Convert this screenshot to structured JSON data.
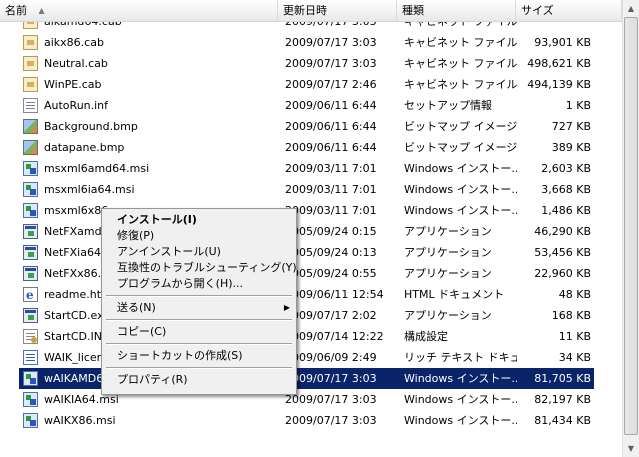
{
  "header": {
    "columns": [
      "名前",
      "更新日時",
      "種類",
      "サイズ"
    ],
    "sort_indicator": "▲"
  },
  "files": [
    {
      "name": "aikamd64.cab",
      "date": "2009/07/17 3:03",
      "type": "キャビネット ファイル",
      "size": "",
      "icon": "cabinet-file-icon"
    },
    {
      "name": "aikx86.cab",
      "date": "2009/07/17 3:03",
      "type": "キャビネット ファイル",
      "size": "93,901 KB",
      "icon": "cabinet-file-icon"
    },
    {
      "name": "Neutral.cab",
      "date": "2009/07/17 3:03",
      "type": "キャビネット ファイル",
      "size": "498,621 KB",
      "icon": "cabinet-file-icon"
    },
    {
      "name": "WinPE.cab",
      "date": "2009/07/17 2:46",
      "type": "キャビネット ファイル",
      "size": "494,139 KB",
      "icon": "cabinet-file-icon"
    },
    {
      "name": "AutoRun.inf",
      "date": "2009/06/11 6:44",
      "type": "セットアップ情報",
      "size": "1 KB",
      "icon": "setup-info-icon"
    },
    {
      "name": "Background.bmp",
      "date": "2009/06/11 6:44",
      "type": "ビットマップ イメージ",
      "size": "727 KB",
      "icon": "bitmap-image-icon"
    },
    {
      "name": "datapane.bmp",
      "date": "2009/06/11 6:44",
      "type": "ビットマップ イメージ",
      "size": "389 KB",
      "icon": "bitmap-image-icon"
    },
    {
      "name": "msxml6amd64.msi",
      "date": "2009/03/11 7:01",
      "type": "Windows インストー...",
      "size": "2,603 KB",
      "icon": "windows-installer-icon"
    },
    {
      "name": "msxml6ia64.msi",
      "date": "2009/03/11 7:01",
      "type": "Windows インストー...",
      "size": "3,668 KB",
      "icon": "windows-installer-icon"
    },
    {
      "name": "msxml6x86",
      "date": "2009/03/11 7:01",
      "type": "Windows インストー...",
      "size": "1,486 KB",
      "icon": "windows-installer-icon"
    },
    {
      "name": "NetFXamd",
      "date": "2005/09/24 0:15",
      "type": "アプリケーション",
      "size": "46,290 KB",
      "icon": "application-icon"
    },
    {
      "name": "NetFXia64.",
      "date": "2005/09/24 0:13",
      "type": "アプリケーション",
      "size": "53,456 KB",
      "icon": "application-icon"
    },
    {
      "name": "NetFXx86.e",
      "date": "2005/09/24 0:55",
      "type": "アプリケーション",
      "size": "22,960 KB",
      "icon": "application-icon"
    },
    {
      "name": "readme.htm",
      "date": "2009/06/11 12:54",
      "type": "HTML ドキュメント",
      "size": "48 KB",
      "icon": "html-document-icon"
    },
    {
      "name": "StartCD.ex",
      "date": "2009/07/17 2:02",
      "type": "アプリケーション",
      "size": "168 KB",
      "icon": "application-icon"
    },
    {
      "name": "StartCD.IN",
      "date": "2009/07/14 12:22",
      "type": "構成設定",
      "size": "11 KB",
      "icon": "config-settings-icon"
    },
    {
      "name": "WAIK_licen",
      "date": "2009/06/09 2:49",
      "type": "リッチ テキスト ドキュ...",
      "size": "34 KB",
      "icon": "rich-text-icon"
    },
    {
      "name": "wAIKAMD64.msi",
      "date": "2009/07/17 3:03",
      "type": "Windows インストー...",
      "size": "81,705 KB",
      "icon": "windows-installer-icon",
      "selected": true
    },
    {
      "name": "wAIKIA64.msi",
      "date": "2009/07/17 3:03",
      "type": "Windows インストー...",
      "size": "82,197 KB",
      "icon": "windows-installer-icon"
    },
    {
      "name": "wAIKX86.msi",
      "date": "2009/07/17 3:03",
      "type": "Windows インストー...",
      "size": "81,434 KB",
      "icon": "windows-installer-icon"
    }
  ],
  "context_menu": [
    {
      "label": "インストール(I)",
      "bold": true,
      "name": "install"
    },
    {
      "label": "修復(P)",
      "name": "repair"
    },
    {
      "label": "アンインストール(U)",
      "name": "uninstall"
    },
    {
      "label": "互換性のトラブルシューティング(Y)",
      "name": "troubleshoot-compatibility"
    },
    {
      "label": "プログラムから開く(H)...",
      "name": "open-with"
    },
    {
      "separator": true
    },
    {
      "label": "送る(N)",
      "submenu": true,
      "name": "send-to"
    },
    {
      "separator": true
    },
    {
      "label": "コピー(C)",
      "name": "copy"
    },
    {
      "separator": true
    },
    {
      "label": "ショートカットの作成(S)",
      "name": "create-shortcut"
    },
    {
      "separator": true
    },
    {
      "label": "プロパティ(R)",
      "name": "properties"
    }
  ]
}
